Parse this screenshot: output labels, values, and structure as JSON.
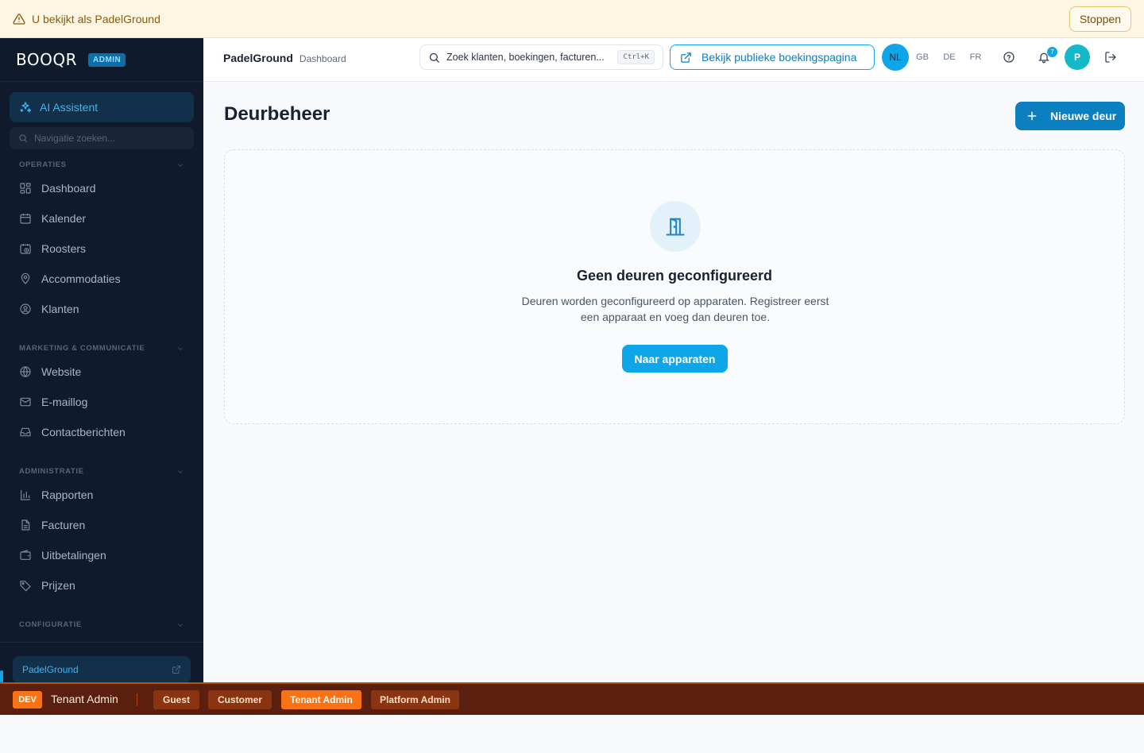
{
  "impersonation": {
    "message": "U bekijkt als PadelGround",
    "stop_label": "Stoppen"
  },
  "sidebar": {
    "logo_text": "BOOQR",
    "admin_badge": "ADMIN",
    "ai_assistant": "AI Assistent",
    "nav_search_placeholder": "Navigatie zoeken...",
    "sections": [
      {
        "title": "OPERATIES",
        "items": [
          "Dashboard",
          "Kalender",
          "Roosters",
          "Accommodaties",
          "Klanten"
        ]
      },
      {
        "title": "MARKETING & COMMUNICATIE",
        "items": [
          "Website",
          "E-maillog",
          "Contactberichten"
        ]
      },
      {
        "title": "ADMINISTRATIE",
        "items": [
          "Rapporten",
          "Facturen",
          "Uitbetalingen",
          "Prijzen"
        ]
      },
      {
        "title": "CONFIGURATIE",
        "items": []
      }
    ],
    "tenant": "PadelGround"
  },
  "header": {
    "tenant_name": "PadelGround",
    "page": "Dashboard",
    "search_placeholder": "Zoek klanten, boekingen, facturen...",
    "search_shortcut": "Ctrl+K",
    "public_page_label": "Bekijk publieke boekingspagina",
    "languages": [
      "NL",
      "GB",
      "DE",
      "FR"
    ],
    "active_language": "NL",
    "notification_count": "7",
    "avatar_initial": "P"
  },
  "main": {
    "title": "Deurbeheer",
    "new_button": "Nieuwe deur",
    "empty_title": "Geen deuren geconfigureerd",
    "empty_desc": "Deuren worden geconfigureerd op apparaten. Registreer eerst een apparaat en voeg dan deuren toe.",
    "empty_button": "Naar apparaten"
  },
  "devbar": {
    "env": "DEV",
    "current_role": "Tenant Admin",
    "roles": [
      "Guest",
      "Customer",
      "Tenant Admin",
      "Platform Admin"
    ],
    "active_role": "Tenant Admin"
  },
  "colors": {
    "accent": "#0ea5e9",
    "sidebar_bg": "#0f1b2d",
    "dev_bar": "#5a1f0e",
    "dev_accent": "#f97316"
  }
}
